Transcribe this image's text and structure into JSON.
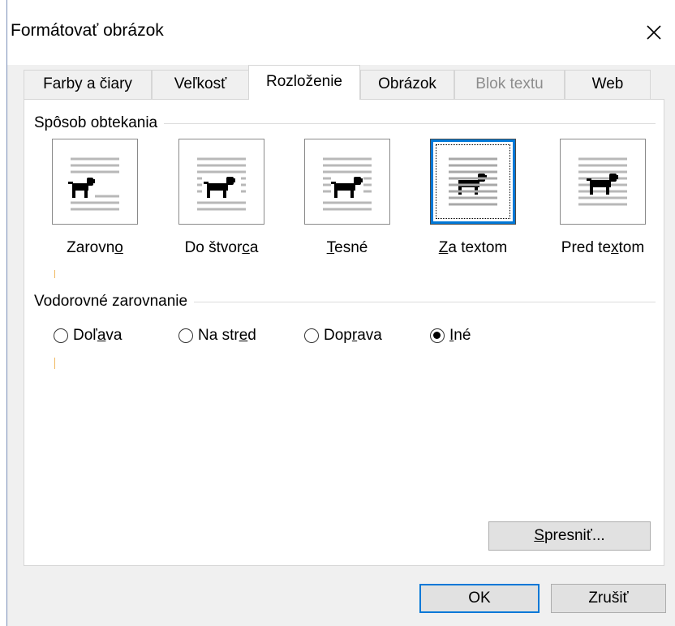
{
  "dialog": {
    "title": "Formátovať obrázok",
    "close_glyph": "✕"
  },
  "tabs": [
    {
      "label": "Farby a čiary",
      "state": "normal"
    },
    {
      "label": "Veľkosť",
      "state": "normal"
    },
    {
      "label": "Rozloženie",
      "state": "active"
    },
    {
      "label": "Obrázok",
      "state": "normal"
    },
    {
      "label": "Blok textu",
      "state": "disabled"
    },
    {
      "label": "Web",
      "state": "normal"
    }
  ],
  "wrapping": {
    "group_label": "Spôsob obtekania",
    "options": [
      {
        "pre": "Zarovn",
        "key": "o",
        "post": "",
        "selected": false,
        "icon": "inline-wrap-icon"
      },
      {
        "pre": "Do štvor",
        "key": "c",
        "post": "a",
        "selected": false,
        "icon": "square-wrap-icon"
      },
      {
        "pre": "",
        "key": "T",
        "post": "esné",
        "selected": false,
        "icon": "tight-wrap-icon"
      },
      {
        "pre": "",
        "key": "Z",
        "post": "a textom",
        "selected": true,
        "icon": "behind-text-wrap-icon"
      },
      {
        "pre": "Pred te",
        "key": "x",
        "post": "tom",
        "selected": false,
        "icon": "in-front-of-text-wrap-icon"
      }
    ]
  },
  "alignment": {
    "group_label": "Vodorovné zarovnanie",
    "options": [
      {
        "pre": "Doľ",
        "key": "a",
        "post": "va",
        "checked": false
      },
      {
        "pre": "Na str",
        "key": "e",
        "post": "d",
        "checked": false
      },
      {
        "pre": "Dop",
        "key": "r",
        "post": "ava",
        "checked": false
      },
      {
        "pre": "",
        "key": "I",
        "post": "né",
        "checked": true
      }
    ]
  },
  "buttons": {
    "advanced": {
      "pre": "",
      "key": "S",
      "post": "presniť..."
    },
    "ok": "OK",
    "cancel": "Zrušiť"
  },
  "colors": {
    "accent": "#0078d7",
    "dialog_bg": "#f0f0f0",
    "panel_bg": "#ffffff",
    "disabled_text": "#8d8d8d"
  }
}
